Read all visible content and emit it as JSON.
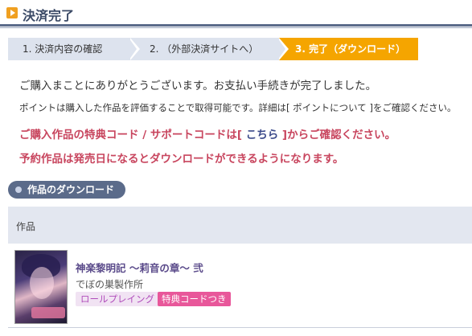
{
  "header": {
    "title": "決済完了"
  },
  "steps": [
    {
      "label": "1. 決済内容の確認"
    },
    {
      "label": "2. （外部決済サイトへ）"
    },
    {
      "label": "3. 完了（ダウンロード）"
    }
  ],
  "messages": {
    "thanks": "ご購入まことにありがとうございます。お支払い手続きが完了しました。",
    "points": "ポイントは購入した作品を評価することで取得可能です。詳細は[ ポイントについて ]をご確認ください。",
    "code_prefix": "ご購入作品の特典コード / サポートコードは[ ",
    "code_link": "こちら",
    "code_suffix": " ]からご確認ください。",
    "preorder": "予約作品は発売日になるとダウンロードができるようになります。"
  },
  "section": {
    "title": "作品のダウンロード"
  },
  "table": {
    "header": "作品",
    "items": [
      {
        "title": "神楽黎明記 ～莉音の章～ 弐",
        "maker": "でぼの巣製作所",
        "genre": "ロールプレイング",
        "badge": "特典コードつき"
      }
    ]
  },
  "colors": {
    "accent": "#f5a500",
    "navy": "#5b6b8a",
    "alert": "#c8455e",
    "badge": "#e8579a"
  }
}
